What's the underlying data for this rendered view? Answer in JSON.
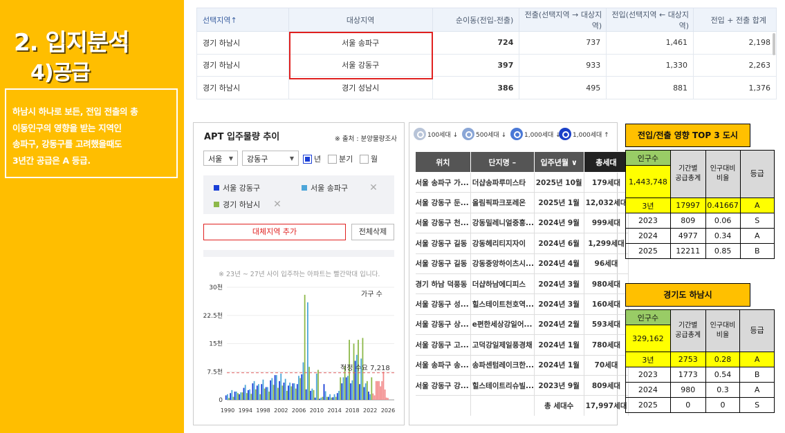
{
  "slide": {
    "title_1": "2. 입지분석",
    "title_2": "4)공급",
    "description": [
      "하남시 하나로 보든, 전입 전출의 총",
      "이동인구의 영향을 받는 지역인",
      "송파구, 강동구를 고려했을때도",
      "3년간 공급은 A 등급."
    ]
  },
  "migration_table": {
    "headers": [
      "선택지역↑",
      "대상지역",
      "순이동(전입-전출)",
      "전출(선택지역 → 대상지역)",
      "전입(선택지역 ← 대상지역)",
      "전입 + 전출 합계"
    ],
    "rows": [
      [
        "경기 하남시",
        "서울 송파구",
        "724",
        "737",
        "1,461",
        "2,198"
      ],
      [
        "경기 하남시",
        "서울 강동구",
        "397",
        "933",
        "1,330",
        "2,263"
      ],
      [
        "경기 하남시",
        "경기 성남시",
        "386",
        "495",
        "881",
        "1,376"
      ]
    ]
  },
  "supply_chart_panel": {
    "title": "APT 입주물량 추이",
    "source": "※ 출처 : 분양물량조사",
    "region_select": "서울",
    "district_select": "강동구",
    "period_options": [
      {
        "label": "년",
        "checked": true
      },
      {
        "label": "분기",
        "checked": false
      },
      {
        "label": "월",
        "checked": false
      }
    ],
    "legend": [
      {
        "label": "서울 강동구",
        "color": "#1a3fd6"
      },
      {
        "label": "서울 송파구",
        "color": "#4da6d9"
      },
      {
        "label": "경기 하남시",
        "color": "#8db84a"
      }
    ],
    "add_button": "대체지역 추가",
    "clear_button": "전체삭제",
    "note": "※ 23년 ~ 27년 사이 입주하는 아파트는 빨간막대 입니다.",
    "unit_label": "가구 수",
    "demand_label": "적정 수요 7,218"
  },
  "chart_data": {
    "type": "bar",
    "title": "APT 입주물량 추이",
    "ylabel": "가구 수",
    "ylim": [
      0,
      30000
    ],
    "yticks": [
      "0",
      "7.5천",
      "15천",
      "22.5천",
      "30천"
    ],
    "xticks": [
      "1990",
      "1994",
      "1998",
      "2002",
      "2006",
      "2010",
      "2014",
      "2018",
      "2022",
      "2026"
    ],
    "xlim": [
      1990,
      2026
    ],
    "reference_line": {
      "label": "적정 수요 7,218",
      "value": 7218
    },
    "highlight_years": [
      2023,
      2024,
      2025,
      2026,
      2027
    ],
    "years": [
      1990,
      1991,
      1992,
      1993,
      1994,
      1995,
      1996,
      1997,
      1998,
      1999,
      2000,
      2001,
      2002,
      2003,
      2004,
      2005,
      2006,
      2007,
      2008,
      2009,
      2010,
      2011,
      2012,
      2013,
      2014,
      2015,
      2016,
      2017,
      2018,
      2019,
      2020,
      2021,
      2022,
      2023,
      2024,
      2025,
      2026
    ],
    "series": [
      {
        "name": "서울 강동구",
        "color": "#1a3fd6",
        "values": [
          1200,
          1800,
          2200,
          1500,
          3200,
          2600,
          4400,
          3800,
          4200,
          3400,
          5200,
          6600,
          5000,
          4600,
          3800,
          4400,
          4200,
          6800,
          2800,
          2400,
          600,
          300,
          4200,
          800,
          700,
          1800,
          4400,
          6000,
          4400,
          10400,
          4200,
          3400,
          2200,
          1700,
          5000,
          4977,
          600
        ]
      },
      {
        "name": "서울 송파구",
        "color": "#4da6d9",
        "values": [
          1500,
          2600,
          2200,
          2000,
          4000,
          2800,
          5000,
          4200,
          5400,
          3400,
          5800,
          6600,
          7000,
          5600,
          4600,
          4400,
          6400,
          10000,
          26000,
          3000,
          7000,
          600,
          2300,
          1500,
          1500,
          2400,
          6000,
          6400,
          5200,
          12000,
          11000,
          4400,
          1500,
          1200,
          5000,
          7500,
          500
        ]
      },
      {
        "name": "경기 하남시",
        "color": "#8db84a",
        "values": [
          500,
          800,
          1800,
          2000,
          1800,
          1600,
          2800,
          1500,
          3000,
          2200,
          4000,
          3200,
          3800,
          2400,
          3600,
          3000,
          5800,
          28000,
          8800,
          2600,
          8000,
          800,
          800,
          600,
          800,
          6000,
          9000,
          16000,
          15000,
          16000,
          16500,
          5000,
          6000,
          5000,
          3600,
          2753,
          0
        ]
      }
    ]
  },
  "complex_list": {
    "size_filters": [
      {
        "label": "100세대 ↓",
        "color": "#b8c4d8"
      },
      {
        "label": "500세대 ↓",
        "color": "#8aa6d6"
      },
      {
        "label": "1,000세대 ↓",
        "color": "#4a78d6"
      },
      {
        "label": "1,000세대 ↑",
        "color": "#1a40c8"
      }
    ],
    "headers": [
      "위치",
      "단지명 –",
      "입주년월 ∨",
      "총세대"
    ],
    "rows": [
      [
        "서울 송파구 가...",
        "더샵송파루미스타",
        "2025년 10월",
        "179세대"
      ],
      [
        "서울 강동구 둔...",
        "올림픽파크포레온",
        "2025년 1월",
        "12,032세대"
      ],
      [
        "서울 강동구 천...",
        "강동밀레니얼중흥...",
        "2024년 9월",
        "999세대"
      ],
      [
        "서울 강동구 길동",
        "강동헤리티지자이",
        "2024년 6월",
        "1,299세대"
      ],
      [
        "서울 강동구 길동",
        "강동중앙하이츠시...",
        "2024년 4월",
        "96세대"
      ],
      [
        "경기 하남 덕풍동",
        "더샵하남에디피스",
        "2024년 3월",
        "980세대"
      ],
      [
        "서울 강동구 성...",
        "힐스테이트천호역...",
        "2024년 3월",
        "160세대"
      ],
      [
        "서울 강동구 상...",
        "e편한세상강일어...",
        "2024년 2월",
        "593세대"
      ],
      [
        "서울 강동구 고...",
        "고덕강일제일풍경채",
        "2024년 1월",
        "780세대"
      ],
      [
        "서울 송파구 송...",
        "송파센텀레이크한...",
        "2024년 1월",
        "70세대"
      ],
      [
        "서울 강동구 강...",
        "힐스테이트리슈빌...",
        "2023년 9월",
        "809세대"
      ]
    ],
    "total_label": "총 세대수",
    "total_value": "17,997세대"
  },
  "grade_top3": {
    "title": "전입/전출 영향 TOP 3 도시",
    "pop_label": "인구수",
    "pop_value": "1,443,748",
    "col_supply": [
      "기간별",
      "공급총계"
    ],
    "col_ratio": [
      "인구대비",
      "비율"
    ],
    "col_grade": "등급",
    "rows": [
      [
        "3년",
        "17997",
        "0.41667",
        "A"
      ],
      [
        "2023",
        "809",
        "0.06",
        "S"
      ],
      [
        "2024",
        "4977",
        "0.34",
        "A"
      ],
      [
        "2025",
        "12211",
        "0.85",
        "B"
      ]
    ]
  },
  "grade_hanam": {
    "title": "경기도 하남시",
    "pop_label": "인구수",
    "pop_value": "329,162",
    "col_supply": [
      "기간별",
      "공급총계"
    ],
    "col_ratio": [
      "인구대비",
      "비율"
    ],
    "col_grade": "등급",
    "rows": [
      [
        "3년",
        "2753",
        "0.28",
        "A"
      ],
      [
        "2023",
        "1773",
        "0.54",
        "B"
      ],
      [
        "2024",
        "980",
        "0.3",
        "A"
      ],
      [
        "2025",
        "0",
        "0",
        "S"
      ]
    ]
  },
  "colors": {
    "brand_yellow": "#ffbe00",
    "highlight_red": "#e0201f",
    "net_purple": "#6a43c9",
    "highlight_bar": "#f28b8b"
  }
}
